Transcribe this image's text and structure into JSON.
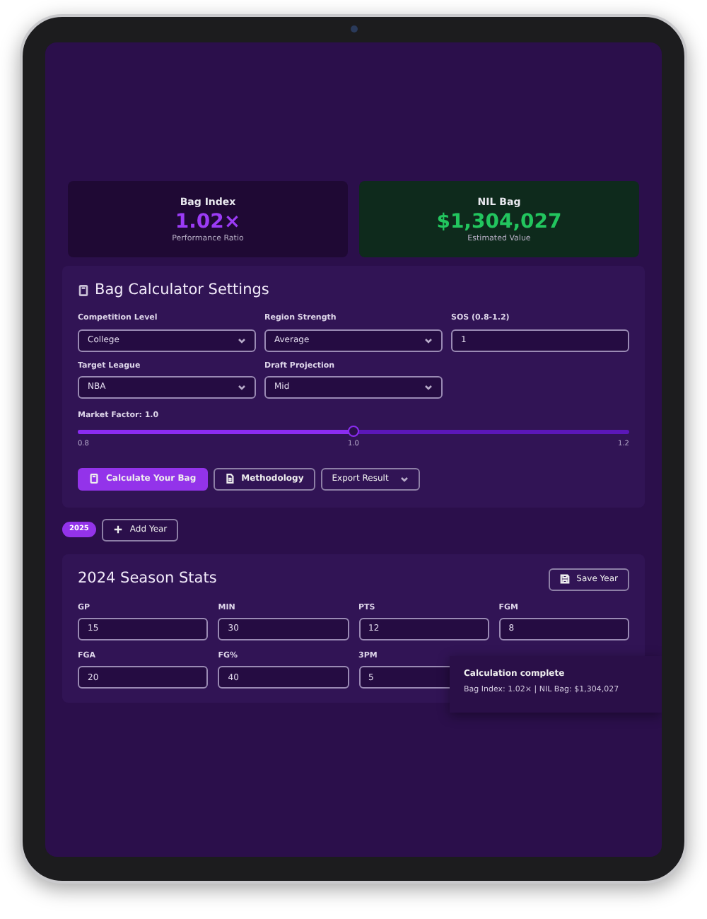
{
  "summary": [
    {
      "kind": "index",
      "label": "Bag Index",
      "value": "1.02×",
      "caption": "Performance Ratio"
    },
    {
      "kind": "money",
      "label": "NIL Bag",
      "value": "$1,304,027",
      "caption": "Estimated Value"
    }
  ],
  "settings": {
    "title": "Bag Calculator Settings",
    "fields": [
      {
        "kind": "select",
        "label": "Competition Level",
        "value": "College"
      },
      {
        "kind": "select",
        "label": "Region Strength",
        "value": "Average"
      },
      {
        "kind": "input",
        "label": "SOS (0.8-1.2)",
        "value": "1"
      },
      {
        "kind": "select",
        "label": "Target League",
        "value": "NBA"
      },
      {
        "kind": "select",
        "label": "Draft Projection",
        "value": "Mid"
      }
    ],
    "slider": {
      "label": "Market Factor: 1.0",
      "level": 0.5,
      "ticks": [
        "0.8",
        "1.0",
        "1.2"
      ]
    },
    "buttons": [
      {
        "kind": "primary",
        "label": "Calculate Your Bag"
      },
      {
        "kind": "outline",
        "label": "Methodology"
      },
      {
        "kind": "dropdown",
        "label": "Export Result"
      }
    ]
  },
  "years": {
    "tabs": [
      {
        "label": "2025",
        "selected": true
      }
    ],
    "add_button": "Add Year"
  },
  "stats": {
    "title": "2024 Season Stats",
    "save_button": "Save Year",
    "fields": [
      {
        "kind": "input",
        "label": "GP",
        "value": "15"
      },
      {
        "kind": "input",
        "label": "MIN",
        "value": "30"
      },
      {
        "kind": "input",
        "label": "PTS",
        "value": "12"
      },
      {
        "kind": "input",
        "label": "FGM",
        "value": "8"
      },
      {
        "kind": "input",
        "label": "FGA",
        "value": "20"
      },
      {
        "kind": "input",
        "label": "FG%",
        "value": "40"
      },
      {
        "kind": "input",
        "label": "3PM",
        "value": "5"
      }
    ]
  },
  "toast": {
    "title": "Calculation complete",
    "message": "Bag Index: 1.02× | NIL Bag: $1,304,027"
  }
}
